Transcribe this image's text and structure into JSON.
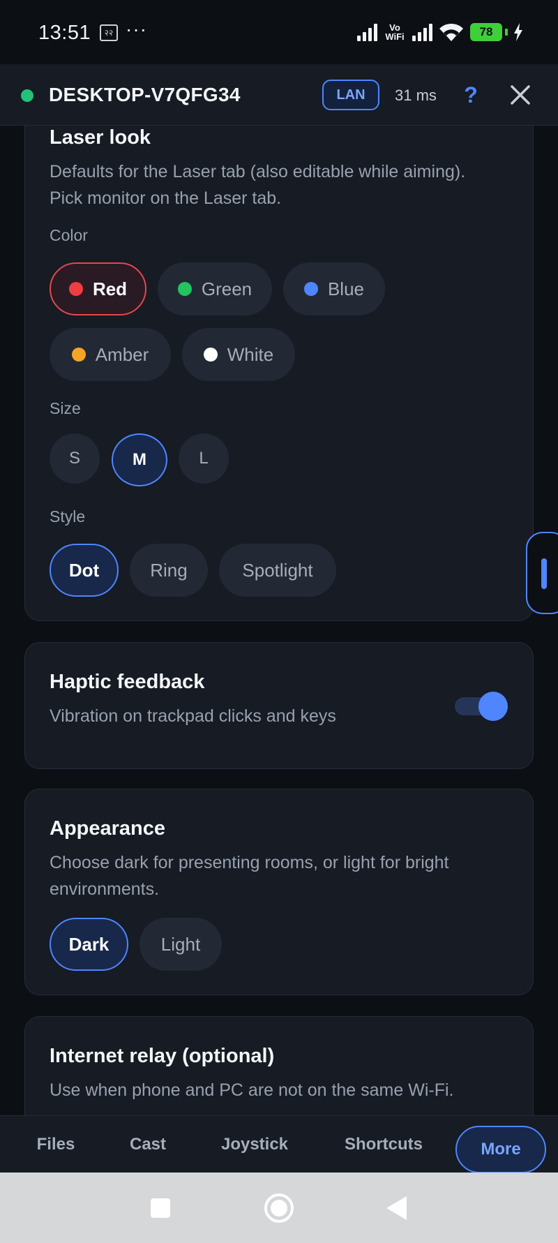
{
  "status_bar": {
    "time": "13:51",
    "sim_label": "२२",
    "more_dots": "···",
    "vowifi_top": "Vo",
    "vowifi_bottom": "WiFi",
    "battery": "78",
    "icons": [
      "signal-icon",
      "vowifi-icon",
      "signal-icon",
      "wifi-icon",
      "battery-icon",
      "charging-icon"
    ]
  },
  "header": {
    "host": "DESKTOP-V7QFG34",
    "badge": "LAN",
    "latency": "31 ms",
    "help": "?",
    "status_color": "#22c27a",
    "accent_color": "#4f86ff"
  },
  "laser": {
    "title": "Laser look",
    "description": "Defaults for the Laser tab (also editable while aiming). Pick monitor on the Laser tab.",
    "color_label": "Color",
    "colors": [
      {
        "label": "Red",
        "swatch": "#ef3d44",
        "selected": true
      },
      {
        "label": "Green",
        "swatch": "#22c55e",
        "selected": false
      },
      {
        "label": "Blue",
        "swatch": "#4f86ff",
        "selected": false
      },
      {
        "label": "Amber",
        "swatch": "#f5a524",
        "selected": false
      },
      {
        "label": "White",
        "swatch": "#ffffff",
        "selected": false
      }
    ],
    "size_label": "Size",
    "sizes": [
      {
        "label": "S",
        "selected": false
      },
      {
        "label": "M",
        "selected": true
      },
      {
        "label": "L",
        "selected": false
      }
    ],
    "style_label": "Style",
    "styles": [
      {
        "label": "Dot",
        "selected": true
      },
      {
        "label": "Ring",
        "selected": false
      },
      {
        "label": "Spotlight",
        "selected": false
      }
    ]
  },
  "haptic": {
    "title": "Haptic feedback",
    "description": "Vibration on trackpad clicks and keys",
    "enabled": true
  },
  "appearance": {
    "title": "Appearance",
    "description": "Choose dark for presenting rooms, or light for bright environments.",
    "options": [
      {
        "label": "Dark",
        "selected": true
      },
      {
        "label": "Light",
        "selected": false
      }
    ]
  },
  "relay": {
    "title": "Internet relay (optional)",
    "description": "Use when phone and PC are not on the same Wi-Fi."
  },
  "tabs": [
    {
      "label": "Files",
      "active": false
    },
    {
      "label": "Cast",
      "active": false
    },
    {
      "label": "Joystick",
      "active": false
    },
    {
      "label": "Shortcuts",
      "active": false
    },
    {
      "label": "More",
      "active": true
    }
  ],
  "nav": {
    "icons": [
      "recents-square-icon",
      "home-circle-icon",
      "back-triangle-icon"
    ]
  }
}
